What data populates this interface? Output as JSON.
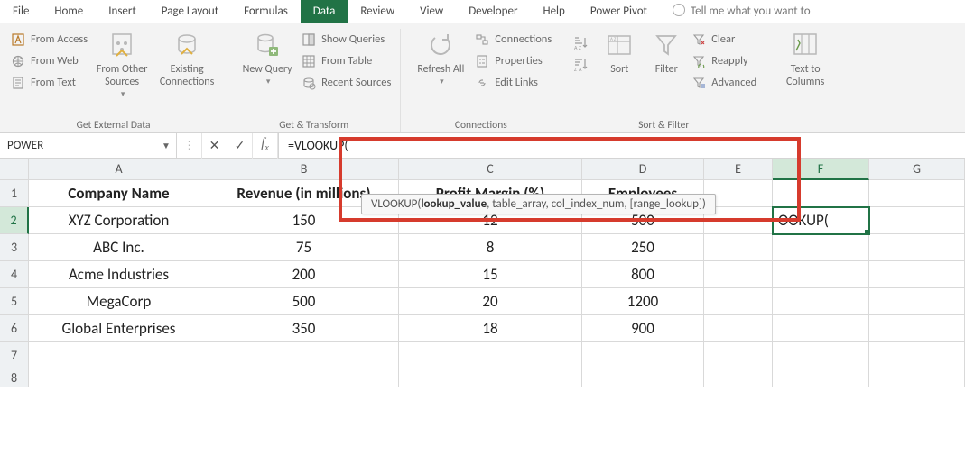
{
  "tabs": [
    "File",
    "Home",
    "Insert",
    "Page Layout",
    "Formulas",
    "Data",
    "Review",
    "View",
    "Developer",
    "Help",
    "Power Pivot"
  ],
  "active_tab": "Data",
  "tell_me": "Tell me what you want to",
  "ribbon": {
    "external": {
      "from_access": "From Access",
      "from_web": "From Web",
      "from_text": "From Text",
      "from_other": "From Other Sources",
      "existing": "Existing Connections",
      "label": "Get External Data"
    },
    "transform": {
      "new_query": "New Query",
      "show_queries": "Show Queries",
      "from_table": "From Table",
      "recent_sources": "Recent Sources",
      "label": "Get & Transform"
    },
    "connections": {
      "refresh_all": "Refresh All",
      "connections": "Connections",
      "properties": "Properties",
      "edit_links": "Edit Links",
      "label": "Connections"
    },
    "sortfilter": {
      "sort": "Sort",
      "filter": "Filter",
      "clear": "Clear",
      "reapply": "Reapply",
      "advanced": "Advanced",
      "label": "Sort & Filter"
    },
    "datatools": {
      "text_to_columns": "Text to Columns"
    }
  },
  "namebox": "POWER",
  "formula": "=VLOOKUP(",
  "tooltip": {
    "func": "VLOOKUP(",
    "arg_bold": "lookup_value",
    "rest": ", table_array, col_index_num, [range_lookup])"
  },
  "columns": [
    "A",
    "B",
    "C",
    "D",
    "E",
    "F",
    "G"
  ],
  "rows": [
    1,
    2,
    3,
    4,
    5,
    6,
    7,
    8
  ],
  "headers": [
    "Company Name",
    "Revenue (in millions)",
    "Profit Margin (%)",
    "Employees"
  ],
  "data": [
    [
      "XYZ Corporation",
      "150",
      "12",
      "500"
    ],
    [
      "ABC Inc.",
      "75",
      "8",
      "250"
    ],
    [
      "Acme Industries",
      "200",
      "15",
      "800"
    ],
    [
      "MegaCorp",
      "500",
      "20",
      "1200"
    ],
    [
      "Global Enterprises",
      "350",
      "18",
      "900"
    ]
  ],
  "active_cell_display": "OOKUP(",
  "active_col": "F",
  "active_row": 2,
  "chart_data": {
    "type": "table",
    "columns": [
      "Company Name",
      "Revenue (in millions)",
      "Profit Margin (%)",
      "Employees"
    ],
    "rows": [
      [
        "XYZ Corporation",
        150,
        12,
        500
      ],
      [
        "ABC Inc.",
        75,
        8,
        250
      ],
      [
        "Acme Industries",
        200,
        15,
        800
      ],
      [
        "MegaCorp",
        500,
        20,
        1200
      ],
      [
        "Global Enterprises",
        350,
        18,
        900
      ]
    ]
  }
}
